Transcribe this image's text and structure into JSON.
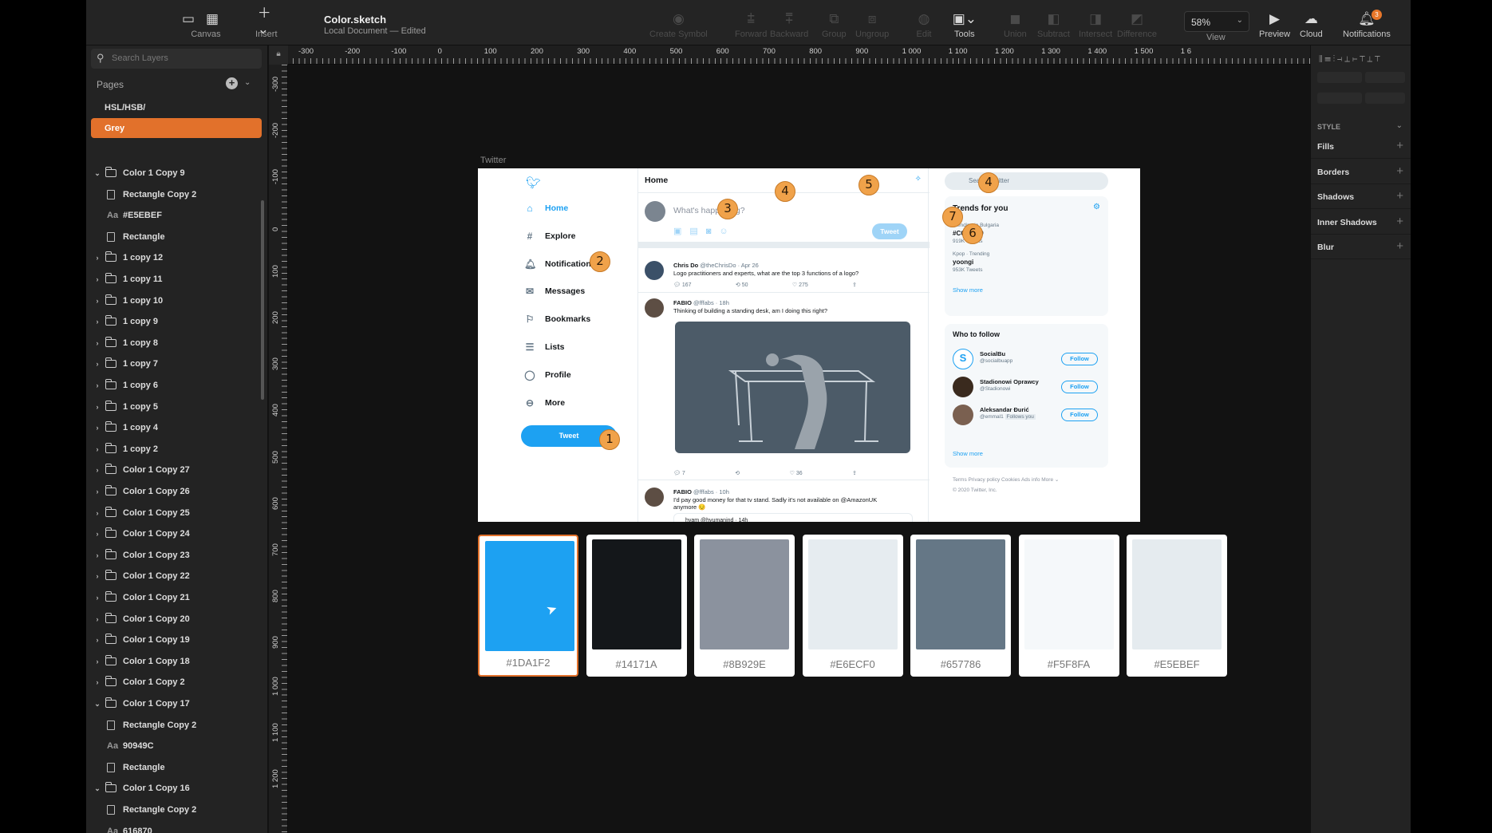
{
  "toolbar": {
    "canvas_label": "Canvas",
    "insert_label": "Insert",
    "doc_title": "Color.sketch",
    "doc_subtitle": "Local Document — Edited",
    "create_symbol": "Create Symbol",
    "forward": "Forward",
    "backward": "Backward",
    "group": "Group",
    "ungroup": "Ungroup",
    "edit": "Edit",
    "tools": "Tools",
    "union": "Union",
    "subtract": "Subtract",
    "intersect": "Intersect",
    "difference": "Difference",
    "zoom": "58%",
    "view": "View",
    "preview": "Preview",
    "cloud": "Cloud",
    "notifications": "Notifications",
    "notif_count": "3"
  },
  "left_panel": {
    "search_placeholder": "Search Layers",
    "pages_header": "Pages",
    "pages": [
      "HSL/HSB/",
      "Grey"
    ],
    "layers": [
      {
        "label": "Color 1 Copy 9",
        "kind": "folder",
        "open": true,
        "indent": 0
      },
      {
        "label": "Rectangle Copy 2",
        "kind": "rect",
        "indent": 1
      },
      {
        "label": "#E5EBEF",
        "kind": "text",
        "indent": 1
      },
      {
        "label": "Rectangle",
        "kind": "rect",
        "indent": 1
      },
      {
        "label": "1 copy 12",
        "kind": "folder",
        "indent": 0
      },
      {
        "label": "1 copy 11",
        "kind": "folder",
        "indent": 0
      },
      {
        "label": "1 copy 10",
        "kind": "folder",
        "indent": 0
      },
      {
        "label": "1 copy 9",
        "kind": "folder",
        "indent": 0
      },
      {
        "label": "1 copy 8",
        "kind": "folder",
        "indent": 0
      },
      {
        "label": "1 copy 7",
        "kind": "folder",
        "indent": 0
      },
      {
        "label": "1 copy 6",
        "kind": "folder",
        "indent": 0
      },
      {
        "label": "1 copy 5",
        "kind": "folder",
        "indent": 0
      },
      {
        "label": "1 copy 4",
        "kind": "folder",
        "indent": 0
      },
      {
        "label": "1 copy 2",
        "kind": "folder",
        "indent": 0
      },
      {
        "label": "Color 1 Copy 27",
        "kind": "folder",
        "indent": 0
      },
      {
        "label": "Color 1 Copy 26",
        "kind": "folder",
        "indent": 0
      },
      {
        "label": "Color 1 Copy 25",
        "kind": "folder",
        "indent": 0
      },
      {
        "label": "Color 1 Copy 24",
        "kind": "folder",
        "indent": 0
      },
      {
        "label": "Color 1 Copy 23",
        "kind": "folder",
        "indent": 0
      },
      {
        "label": "Color 1 Copy 22",
        "kind": "folder",
        "indent": 0
      },
      {
        "label": "Color 1 Copy 21",
        "kind": "folder",
        "indent": 0
      },
      {
        "label": "Color 1 Copy 20",
        "kind": "folder",
        "indent": 0
      },
      {
        "label": "Color 1 Copy 19",
        "kind": "folder",
        "indent": 0
      },
      {
        "label": "Color 1 Copy 18",
        "kind": "folder",
        "indent": 0
      },
      {
        "label": "Color 1 Copy 2",
        "kind": "folder",
        "indent": 0
      },
      {
        "label": "Color 1 Copy 17",
        "kind": "folder",
        "open": true,
        "indent": 0
      },
      {
        "label": "Rectangle Copy 2",
        "kind": "rect",
        "indent": 1
      },
      {
        "label": "90949C",
        "kind": "text",
        "indent": 1
      },
      {
        "label": "Rectangle",
        "kind": "rect",
        "indent": 1
      },
      {
        "label": "Color 1 Copy 16",
        "kind": "folder",
        "open": true,
        "indent": 0
      },
      {
        "label": "Rectangle Copy 2",
        "kind": "rect",
        "indent": 1
      },
      {
        "label": "616870",
        "kind": "text",
        "indent": 1
      }
    ]
  },
  "rulers": {
    "top": [
      "-300",
      "-200",
      "-100",
      "0",
      "100",
      "200",
      "300",
      "400",
      "500",
      "600",
      "700",
      "800",
      "900",
      "1 000",
      "1 100",
      "1 200",
      "1 300",
      "1 400",
      "1 500",
      "1 6"
    ],
    "left": [
      "-300",
      "-200",
      "-100",
      "0",
      "100",
      "200",
      "300",
      "400",
      "500",
      "600",
      "700",
      "800",
      "900",
      "1 000",
      "1 100",
      "1 200"
    ]
  },
  "artboard": {
    "label": "Twitter",
    "nav": [
      "Home",
      "Explore",
      "Notifications",
      "Messages",
      "Bookmarks",
      "Lists",
      "Profile",
      "More"
    ],
    "nav_icons": [
      "home-icon",
      "hash-icon",
      "bell-icon",
      "mail-icon",
      "bookmark-icon",
      "list-icon",
      "profile-icon",
      "more-icon"
    ],
    "tweet_button": "Tweet",
    "feed_title": "Home",
    "composer_placeholder": "What's happening?",
    "composer_button": "Tweet",
    "tweets": [
      {
        "name": "Chris Do",
        "meta": "@theChrisDo · Apr 26",
        "text": "Logo practitioners and experts, what are the top 3 functions of a logo?",
        "replies": "167",
        "retweets": "50",
        "likes": "275"
      },
      {
        "name": "FABIO",
        "meta": "@fffabs · 18h",
        "text": "Thinking of building a standing desk, am I doing this right?",
        "replies": "7",
        "retweets": "",
        "likes": "36"
      },
      {
        "name": "FABIO",
        "meta": "@fffabs · 10h",
        "text": "I'd pay good money for that tv stand. Sadly it's not available on @AmazonUK anymore 😔",
        "quote": "hyam @hyumanind · 14h"
      }
    ],
    "search_placeholder": "Search Twitter",
    "trends_title": "Trends for you",
    "trends": [
      {
        "context": "Trending in Bulgaria",
        "topic": "#COVID19",
        "count": "919K Tweets"
      },
      {
        "context": "Kpop · Trending",
        "topic": "yoongi",
        "count": "953K Tweets"
      }
    ],
    "show_more": "Show more",
    "who_title": "Who to follow",
    "who": [
      {
        "name": "SocialBu",
        "handle": "@socialbuapp",
        "button": "Follow"
      },
      {
        "name": "Stadionowi Oprawcy",
        "handle": "@Stadionowi",
        "button": "Follow"
      },
      {
        "name": "Aleksandar Đurić",
        "handle": "@emmal1",
        "badge": "Follows you",
        "button": "Follow"
      }
    ],
    "footer": "Terms  Privacy policy  Cookies  Ads info  More ⌄",
    "copyright": "© 2020 Twitter, Inc."
  },
  "annotations": [
    "1",
    "2",
    "3",
    "4",
    "4",
    "5",
    "6",
    "7"
  ],
  "swatches": [
    {
      "hex": "#1DA1F2",
      "color": "#1DA1F2",
      "selected": true
    },
    {
      "hex": "#14171A",
      "color": "#14171A"
    },
    {
      "hex": "#8B929E",
      "color": "#8B929E"
    },
    {
      "hex": "#E6ECF0",
      "color": "#E6ECF0"
    },
    {
      "hex": "#657786",
      "color": "#657786"
    },
    {
      "hex": "#F5F8FA",
      "color": "#F5F8FA"
    },
    {
      "hex": "#E5EBEF",
      "color": "#E5EBEF"
    }
  ],
  "inspector": {
    "style_header": "STYLE",
    "rows": [
      "Fills",
      "Borders",
      "Shadows",
      "Inner Shadows",
      "Blur"
    ]
  },
  "colors": {
    "accent": "#E2712B",
    "twitter_blue": "#1DA1F2"
  }
}
